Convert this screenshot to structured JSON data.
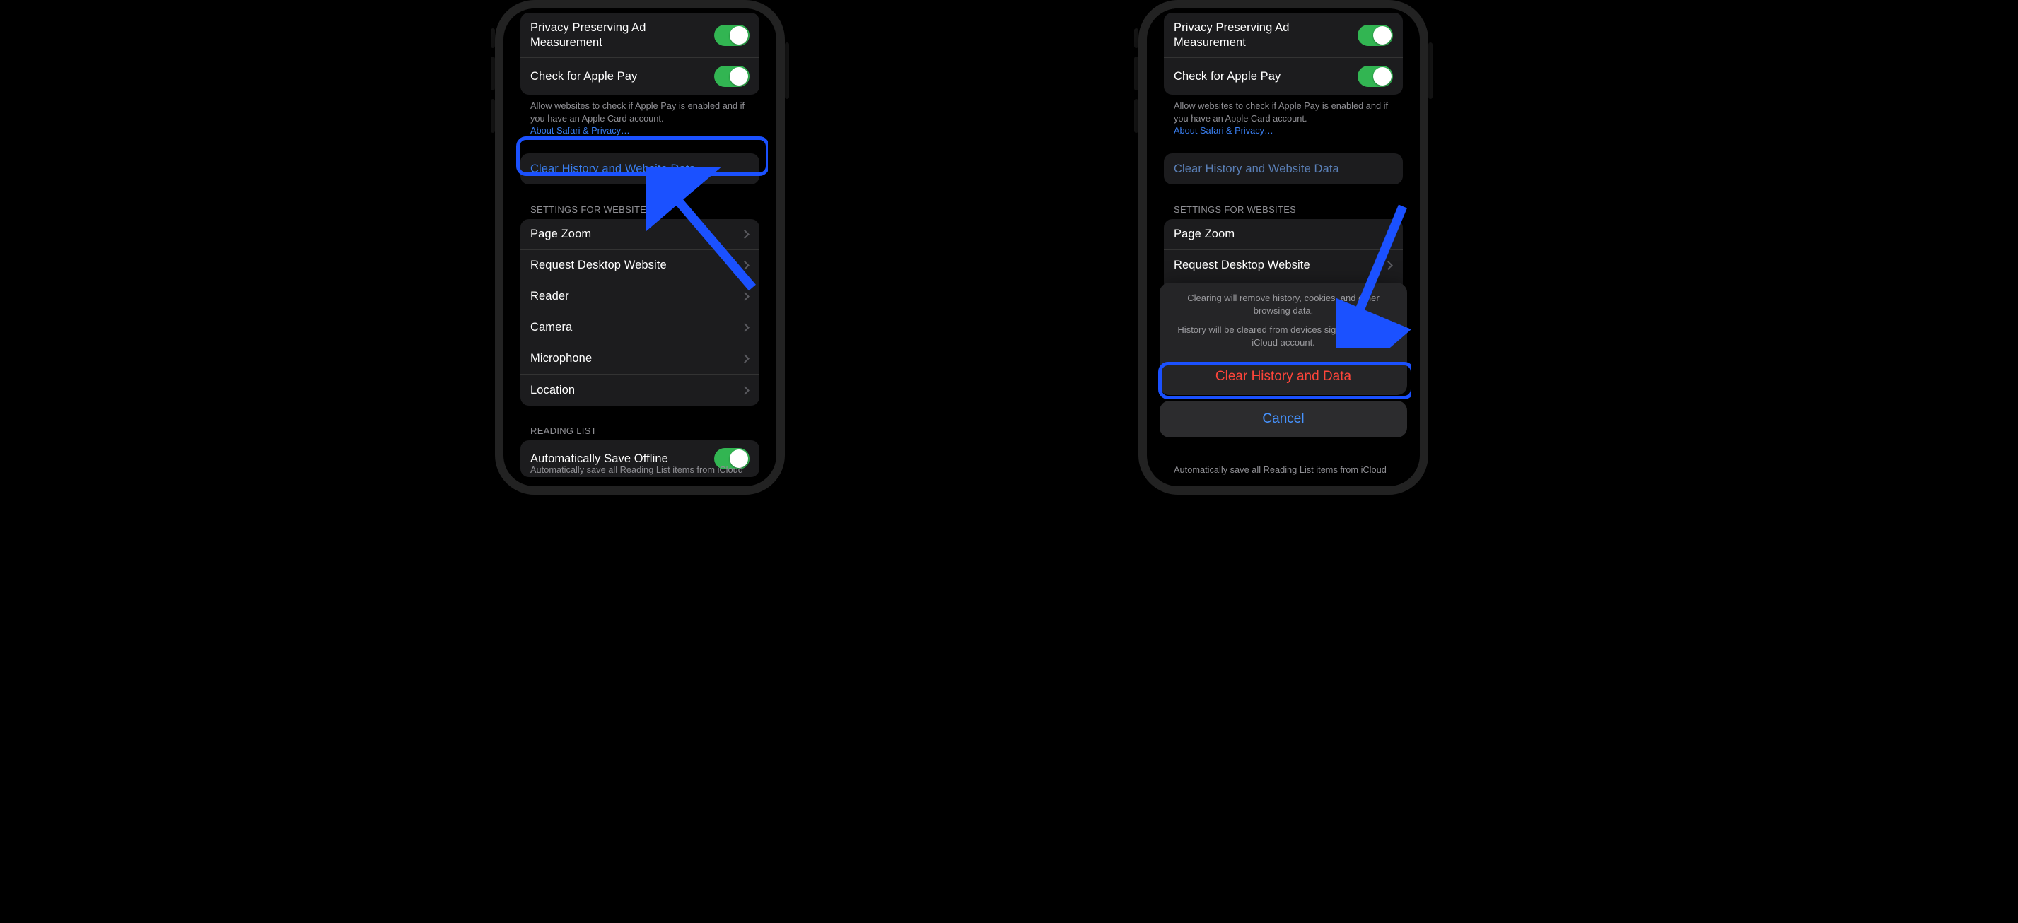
{
  "privacy_group": {
    "item1": "Privacy Preserving Ad Measurement",
    "item2": "Check for Apple Pay"
  },
  "apple_pay_footer": {
    "text": "Allow websites to check if Apple Pay is enabled and if you have an Apple Card account.",
    "link": "About Safari & Privacy…"
  },
  "clear_row": "Clear History and Website Data",
  "settings_header": "SETTINGS FOR WEBSITES",
  "settings_items": {
    "s0": "Page Zoom",
    "s1": "Request Desktop Website",
    "s2": "Reader",
    "s3": "Camera",
    "s4": "Microphone",
    "s5": "Location"
  },
  "reading_header": "READING LIST",
  "reading_item": "Automatically Save Offline",
  "reading_footer": "Automatically save all Reading List items from iCloud",
  "sheet": {
    "msg1": "Clearing will remove history, cookies, and other browsing data.",
    "msg2": "History will be cleared from devices signed into your iCloud account.",
    "action": "Clear History and Data",
    "cancel": "Cancel"
  },
  "colors": {
    "highlight": "#1b51ff",
    "destructive": "#ff453a",
    "toggle_on": "#32b552",
    "link": "#3a7ff1"
  }
}
